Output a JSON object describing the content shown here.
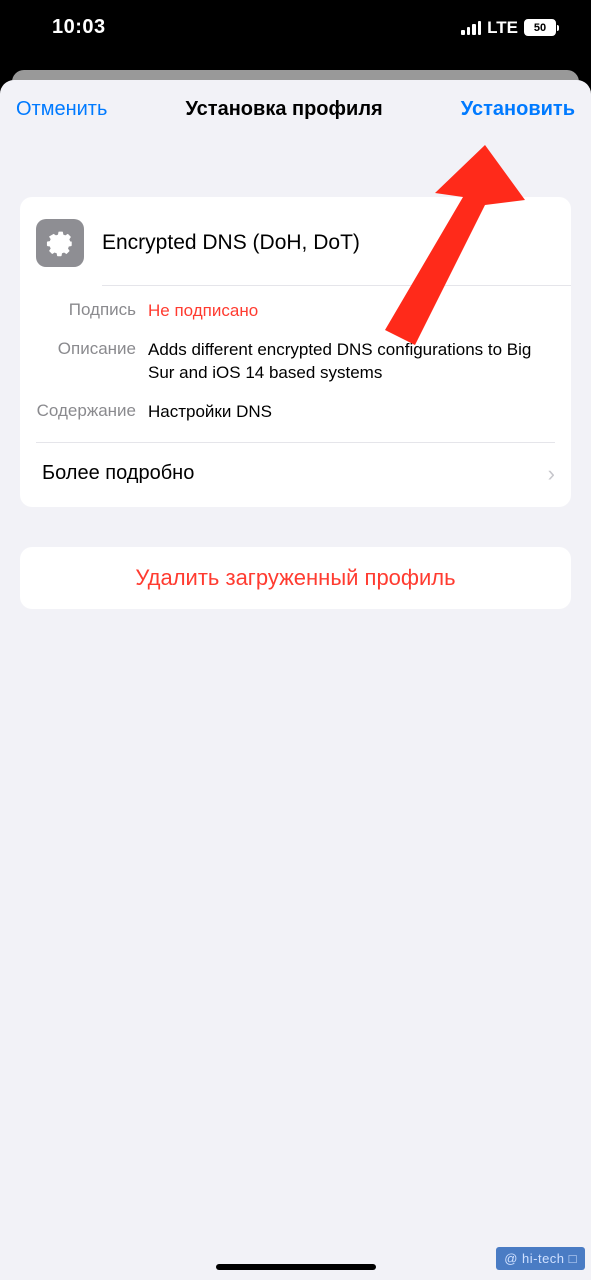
{
  "status": {
    "time": "10:03",
    "network": "LTE",
    "battery": "50"
  },
  "nav": {
    "cancel": "Отменить",
    "title": "Установка профиля",
    "install": "Установить"
  },
  "profile": {
    "name": "Encrypted DNS (DoH, DoT)",
    "signature_label": "Подпись",
    "signature_value": "Не подписано",
    "description_label": "Описание",
    "description_value": "Adds different encrypted DNS configurations to Big Sur and iOS 14 based systems",
    "contents_label": "Содержание",
    "contents_value": "Настройки DNS",
    "more": "Более подробно"
  },
  "delete": {
    "label": "Удалить загруженный профиль"
  },
  "watermark": "@ hi-tech □"
}
